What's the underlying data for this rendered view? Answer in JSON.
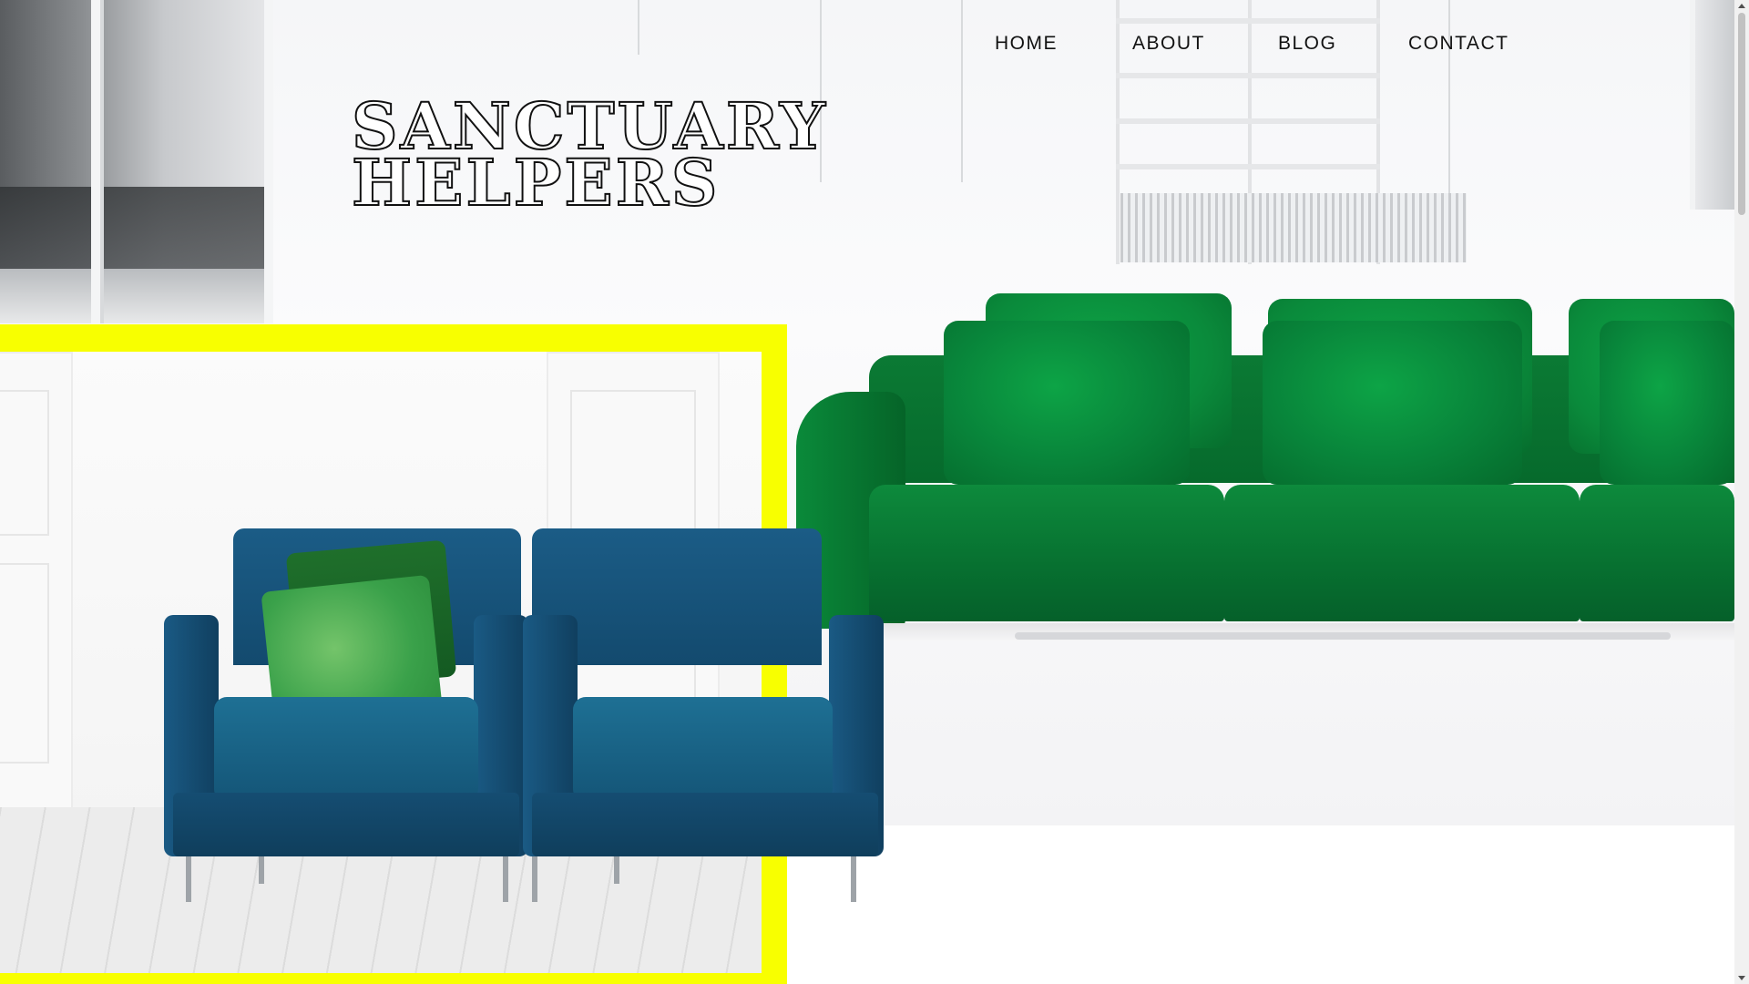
{
  "nav": {
    "items": [
      {
        "label": "HOME"
      },
      {
        "label": "ABOUT"
      },
      {
        "label": "BLOG"
      },
      {
        "label": "CONTACT"
      }
    ]
  },
  "logo": {
    "line1": "SANCTUARY",
    "line2": "HELPERS"
  },
  "colors": {
    "accent_yellow": "#f8ff00",
    "sofa_green": "#0b7a34",
    "chair_blue": "#1b5c86",
    "text": "#111111"
  }
}
